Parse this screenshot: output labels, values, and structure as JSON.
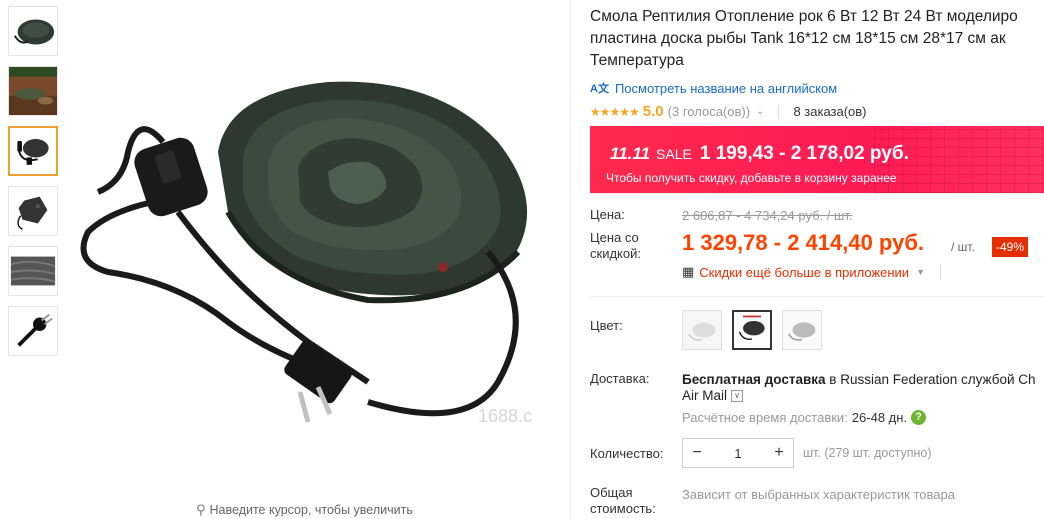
{
  "thumbnails": [
    {
      "name": "thumb-1"
    },
    {
      "name": "thumb-2"
    },
    {
      "name": "thumb-3",
      "active": true
    },
    {
      "name": "thumb-4"
    },
    {
      "name": "thumb-5"
    },
    {
      "name": "thumb-6"
    }
  ],
  "main_image": {
    "watermark": "1688.c",
    "zoom_hint": "Наведите курсор, чтобы увеличить"
  },
  "product": {
    "title_line1": "Смола Рептилия Отопление рок 6 Вт 12 Вт 24 Вт моделиро",
    "title_line2": "пластина доска рыбы Tank 16*12 см 18*15 см 28*17 см ак",
    "title_line3": "Температура",
    "translate_link": "Посмотреть название на английском",
    "rating": "5.0",
    "votes": "(3 голоса(ов))",
    "orders": "8 заказа(ов)"
  },
  "sale": {
    "tag": "11.11",
    "label": "SALE",
    "range": "1 199,43 - 2 178,02 руб.",
    "note": "Чтобы получить скидку, добавьте в корзину заранее"
  },
  "price": {
    "label_price": "Цена:",
    "old": "2 606,87 - 4 734,24 руб. / шт.",
    "label_discount_1": "Цена со",
    "label_discount_2": "скидкой:",
    "new": "1 329,78 - 2 414,40 руб.",
    "per_unit": "/ шт.",
    "discount_badge": "-49%",
    "app_promo": "Скидки ещё больше в приложении"
  },
  "color": {
    "label": "Цвет:",
    "swatches": [
      {
        "name": "white"
      },
      {
        "name": "black",
        "selected": true
      },
      {
        "name": "grey"
      }
    ]
  },
  "shipping": {
    "label": "Доставка:",
    "free": "Бесплатная доставка",
    "to": " в Russian Federation службой Ch",
    "carrier": "Air Mail",
    "time_label": "Расчётное время доставки:",
    "time_value": "26-48 дн."
  },
  "quantity": {
    "label": "Количество:",
    "minus": "−",
    "value": "1",
    "plus": "+",
    "available": "шт. (279 шт. доступно)"
  },
  "total": {
    "label_1": "Общая",
    "label_2": "стоимость:",
    "note": "Зависит от выбранных характеристик товара"
  },
  "colors": {
    "accent": "#ff4400",
    "sale_bg": "#ff2a4d",
    "link": "#1a6cc4",
    "star": "#f5a623",
    "active_thumb": "#f0a030",
    "discount_badge": "#e62e04"
  }
}
